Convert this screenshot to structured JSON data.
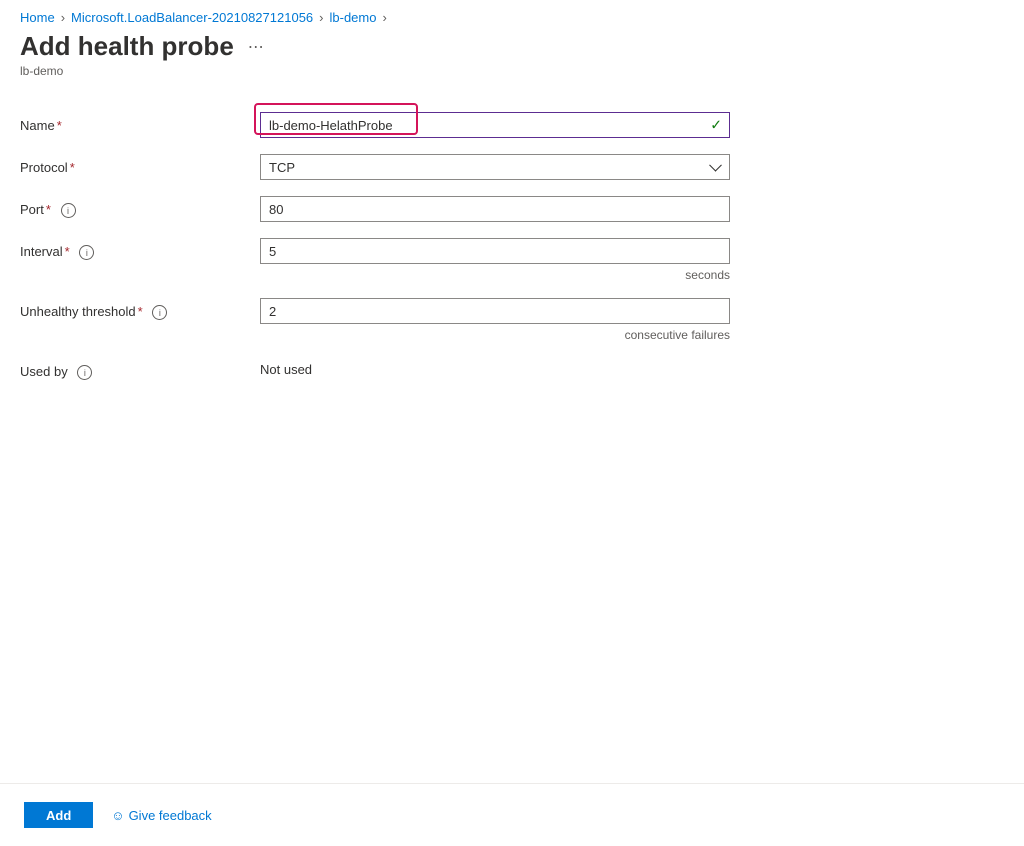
{
  "breadcrumb": {
    "items": [
      {
        "label": "Home"
      },
      {
        "label": "Microsoft.LoadBalancer-20210827121056"
      },
      {
        "label": "lb-demo"
      }
    ]
  },
  "header": {
    "title": "Add health probe",
    "subtitle": "lb-demo"
  },
  "fields": {
    "name": {
      "label": "Name",
      "value": "lb-demo-HelathProbe"
    },
    "protocol": {
      "label": "Protocol",
      "value": "TCP"
    },
    "port": {
      "label": "Port",
      "value": "80"
    },
    "interval": {
      "label": "Interval",
      "value": "5",
      "unit": "seconds"
    },
    "threshold": {
      "label": "Unhealthy threshold",
      "value": "2",
      "unit": "consecutive failures"
    },
    "usedby": {
      "label": "Used by",
      "value": "Not used"
    }
  },
  "footer": {
    "add": "Add",
    "feedback": "Give feedback"
  }
}
